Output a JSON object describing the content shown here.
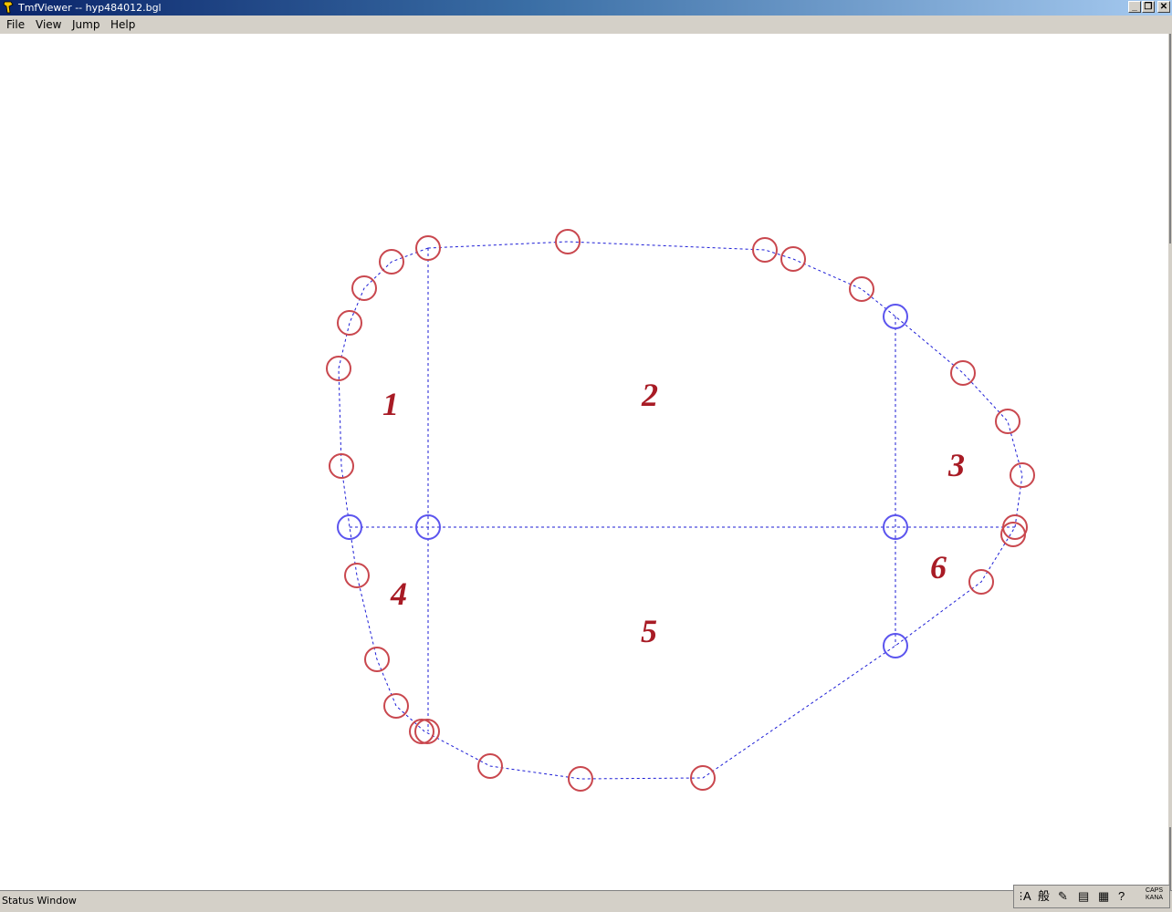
{
  "window": {
    "title": "TmfViewer -- hyp484012.bgl",
    "controls": {
      "minimize": "_",
      "restore": "❐",
      "close": "✕"
    }
  },
  "menu": [
    "File",
    "View",
    "Jump",
    "Help"
  ],
  "diagram": {
    "region_labels": [
      "1",
      "2",
      "3",
      "4",
      "5",
      "6"
    ],
    "colors": {
      "outline_circle": "#c9474e",
      "node_circle": "#5b54ee",
      "edge": "#1c1cd6",
      "label": "#a81b25"
    }
  },
  "status": {
    "text": "Status Window"
  },
  "ime": {
    "a_label": "A",
    "kanji": "般",
    "caps": "CAPS",
    "kana": "KANA"
  }
}
